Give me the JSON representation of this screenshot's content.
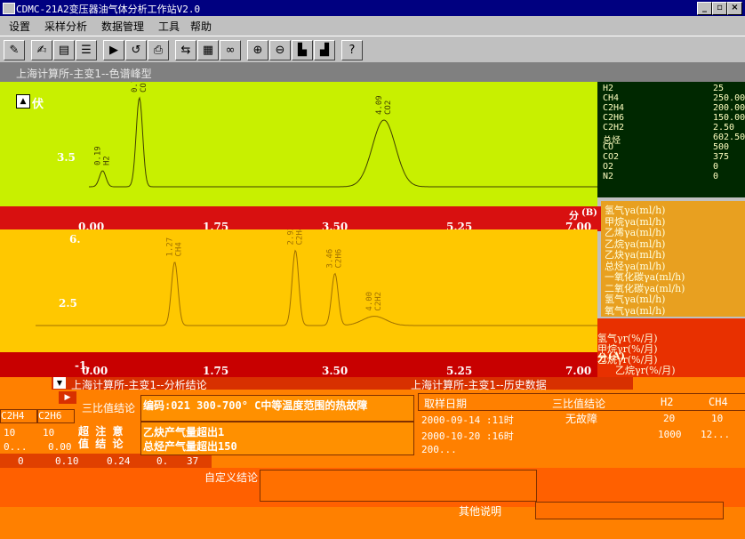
{
  "window": {
    "title": "CDMC-21A2变压器油气体分析工作站V2.0",
    "min": "_",
    "max": "▫",
    "close": "×"
  },
  "menu": [
    "设置",
    "采样分析",
    "数据管理",
    "工具",
    "帮助"
  ],
  "toolbar": [
    {
      "icon": "settings-icon",
      "glyph": "✎"
    },
    {
      "icon": "edit-icon",
      "glyph": "✍"
    },
    {
      "icon": "report-icon",
      "glyph": "▤"
    },
    {
      "icon": "list-icon",
      "glyph": "☰"
    },
    {
      "icon": "play-icon",
      "glyph": "▶"
    },
    {
      "icon": "undo-icon",
      "glyph": "↺"
    },
    {
      "icon": "print-icon",
      "glyph": "⎙"
    },
    {
      "icon": "compare-icon",
      "glyph": "⇆"
    },
    {
      "icon": "palette-icon",
      "glyph": "▦"
    },
    {
      "icon": "binoculars-icon",
      "glyph": "∞"
    },
    {
      "icon": "zoom-in-icon",
      "glyph": "⊕"
    },
    {
      "icon": "zoom-out-icon",
      "glyph": "⊖"
    },
    {
      "icon": "chart-icon",
      "glyph": "▙"
    },
    {
      "icon": "chart2-icon",
      "glyph": "▟"
    },
    {
      "icon": "help-icon",
      "glyph": "?"
    }
  ],
  "chart_title": "上海计算所-主变1--色谱峰型",
  "upper_left_label": "伏",
  "chart_data": [
    {
      "type": "line",
      "title": "",
      "detector": "(B)",
      "xlabel": "分",
      "x_ticks": [
        "0.00",
        "1.75",
        "3.50",
        "5.25",
        "7.00"
      ],
      "y_ticks": [
        "3.5"
      ],
      "xlim": [
        0,
        7.0
      ],
      "peaks": [
        {
          "time": 0.19,
          "name": "H2",
          "label": "0.19",
          "height": 0.18
        },
        {
          "time": 0.7,
          "name": "CO",
          "label": "0.70",
          "height": 1.0
        },
        {
          "time": 4.09,
          "name": "CO2",
          "label": "4.09",
          "height": 0.75
        }
      ]
    },
    {
      "type": "line",
      "title": "",
      "detector": "(A)",
      "xlabel": "分",
      "x_ticks": [
        "0.00",
        "1.75",
        "3.50",
        "5.25",
        "7.00"
      ],
      "y_ticks": [
        "6.",
        "2.5",
        "-1."
      ],
      "xlim": [
        0,
        7.0
      ],
      "peaks": [
        {
          "time": 1.27,
          "name": "CH4",
          "label": "1.27",
          "height": 0.55
        },
        {
          "time": 2.92,
          "name": "C2H4",
          "label": "2.92",
          "height": 0.65
        },
        {
          "time": 3.46,
          "name": "C2H6",
          "label": "3.46",
          "height": 0.45
        },
        {
          "time": 4.0,
          "name": "C2H2",
          "label": "4.00",
          "height": 0.08
        }
      ]
    }
  ],
  "concentrations": [
    {
      "name": "H2",
      "value": "25"
    },
    {
      "name": "CH4",
      "value": "250.00"
    },
    {
      "name": "C2H4",
      "value": "200.00"
    },
    {
      "name": "C2H6",
      "value": "150.00"
    },
    {
      "name": "C2H2",
      "value": "2.50"
    },
    {
      "name": "总烃",
      "value": "602.50"
    },
    {
      "name": "CO",
      "value": "500"
    },
    {
      "name": "CO2",
      "value": "375"
    },
    {
      "name": "O2",
      "value": "0"
    },
    {
      "name": "N2",
      "value": "0"
    }
  ],
  "legend_abs": [
    "氢气γa(ml/h)",
    "甲烷γa(ml/h)",
    "乙烯γa(ml/h)",
    "乙烷γa(ml/h)",
    "乙炔γa(ml/h)",
    "总烃γa(ml/h)",
    "一氧化碳γa(ml/h)",
    "二氧化碳γa(ml/h)",
    "氢气γa(ml/h)",
    "氧气γa(ml/h)"
  ],
  "legend_rel": [
    "氢气γr(%/月)",
    "甲烷γr(%/月)",
    "乙烷γr(%/月)",
    "乙烷γr(%/月)"
  ],
  "analysis_bar": "上海计算所-主变1--分析结论",
  "history_bar": "上海计算所-主变1--历史数据",
  "left_table": {
    "headers": [
      "C2H4",
      "C2H6"
    ],
    "row1": [
      "10",
      "10"
    ],
    "row2": [
      "0...",
      "0.00"
    ],
    "row3": [
      "0",
      "0.10",
      "0.24",
      "0.",
      "37"
    ]
  },
  "three_ratio_label": "三比值结论",
  "three_ratio_text": "编码:021 300-700° C中等温度范围的热故障",
  "attention_label": "超 注 意 值 结 论",
  "attention_lines": [
    "乙炔产气量超出1",
    "总烃产气量超出150"
  ],
  "custom_label": "自定义结论",
  "other_label": "其他说明",
  "history": {
    "headers": [
      "取样日期",
      "三比值结论",
      "H2",
      "CH4"
    ],
    "rows": [
      [
        "2000-09-14 :11时",
        "无故障",
        "20",
        "10"
      ],
      [
        "2000-10-20 :16时",
        "",
        "1000",
        "12..."
      ],
      [
        "200...",
        "",
        "",
        ""
      ]
    ]
  }
}
